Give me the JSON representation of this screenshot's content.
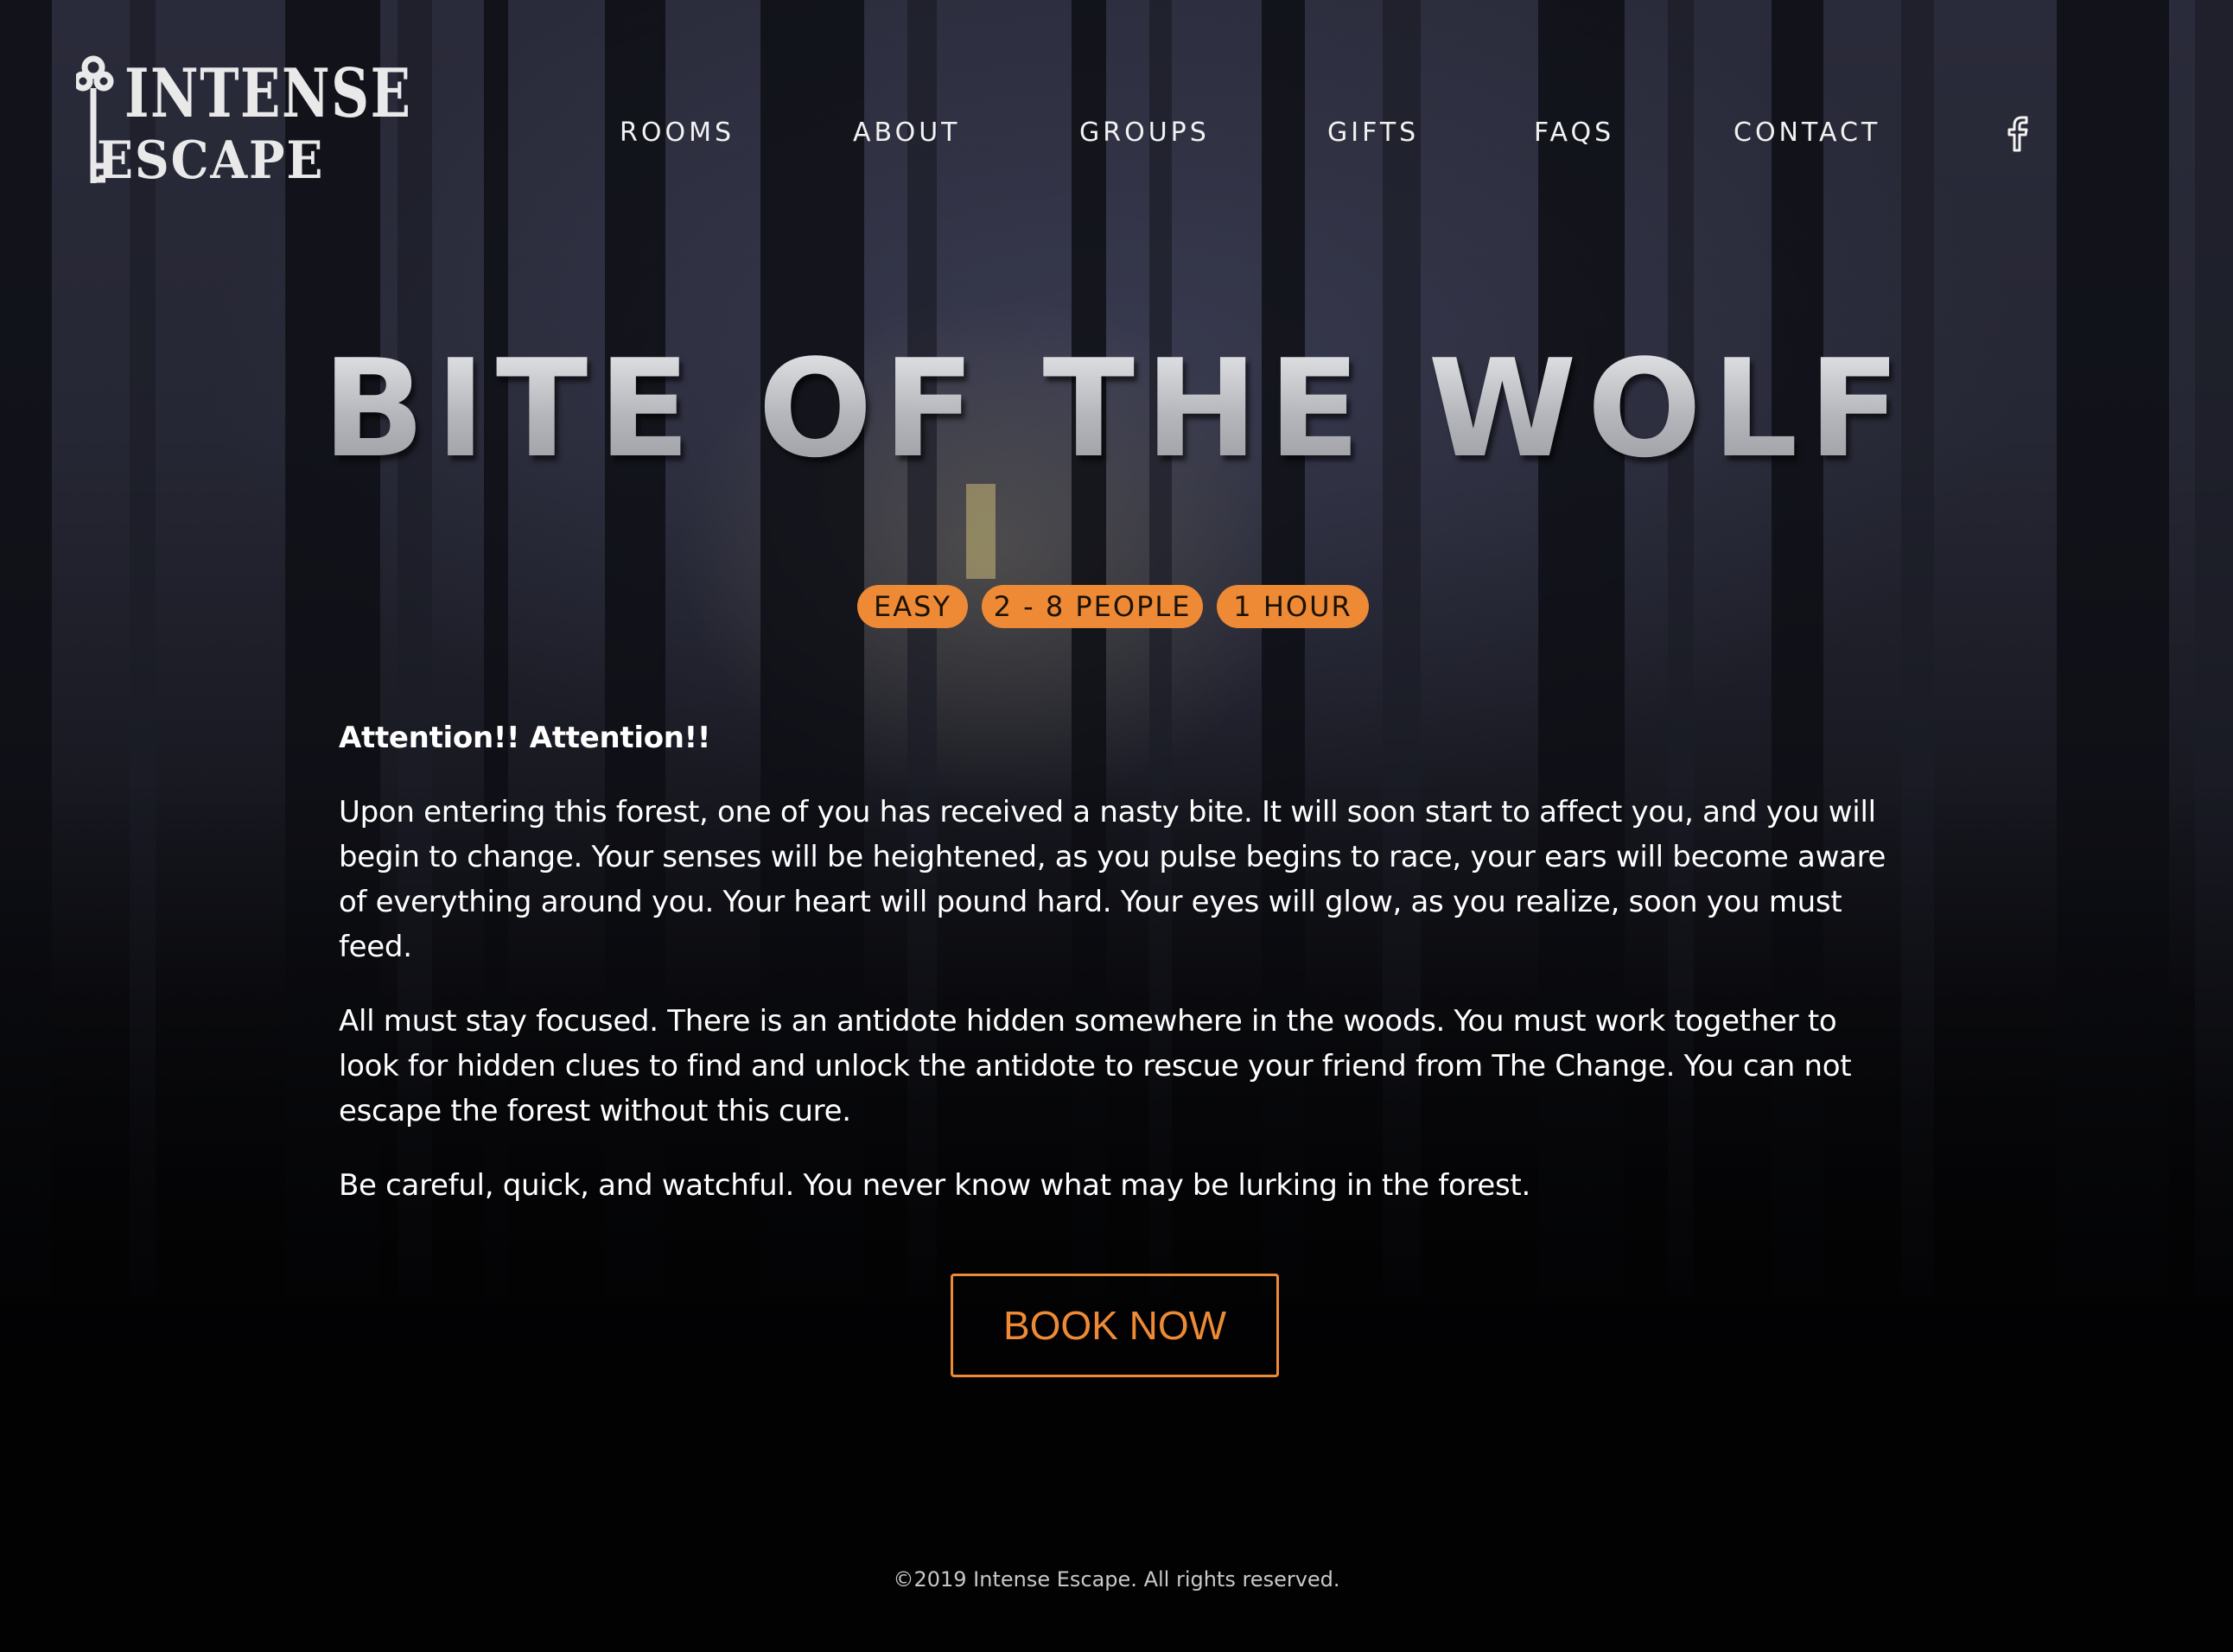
{
  "brand": {
    "logo_line1": "INTENSE",
    "logo_line2": "ESCAPE"
  },
  "nav": {
    "items": [
      {
        "label": "ROOMS"
      },
      {
        "label": "ABOUT"
      },
      {
        "label": "GROUPS"
      },
      {
        "label": "GIFTS"
      },
      {
        "label": "FAQS"
      },
      {
        "label": "CONTACT"
      }
    ],
    "social_icon": "facebook-icon"
  },
  "room": {
    "title": "BITE OF THE WOLF",
    "badges": [
      {
        "label": "EASY"
      },
      {
        "label": "2 - 8 PEOPLE"
      },
      {
        "label": "1 HOUR"
      }
    ],
    "lead": "Attention!! Attention!!",
    "paragraphs": [
      "Upon entering this forest, one of you has received a nasty bite. It will soon start to affect you, and you will begin to change. Your senses will be heightened, as you pulse begins to race, your ears will become aware of everything around you. Your heart will pound hard. Your eyes will glow, as you realize, soon you must feed.",
      "All must stay focused. There is an antidote hidden somewhere in the woods. You must work together to look for hidden clues to find and unlock the antidote to rescue your friend from The Change. You can not escape the forest without this cure.",
      "Be careful, quick, and watchful. You never know what may be lurking in the forest."
    ],
    "book_label": "BOOK NOW"
  },
  "footer": {
    "copyright": "©2019 Intense Escape. All rights reserved."
  },
  "colors": {
    "accent": "#ee8a35",
    "background": "#050506",
    "text": "#ffffff"
  }
}
